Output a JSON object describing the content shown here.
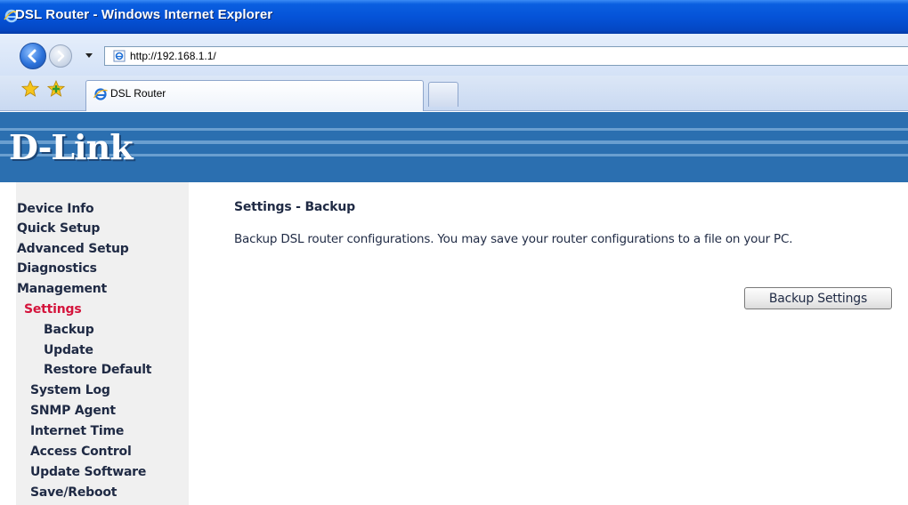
{
  "window": {
    "title": "DSL Router - Windows Internet Explorer"
  },
  "browser": {
    "address_url": "http://192.168.1.1/",
    "tab_label": "DSL Router"
  },
  "brand": {
    "logo_text": "D-Link"
  },
  "sidebar": {
    "items": [
      {
        "label": "Device Info",
        "active": false
      },
      {
        "label": "Quick Setup",
        "active": false
      },
      {
        "label": "Advanced Setup",
        "active": false
      },
      {
        "label": "Diagnostics",
        "active": false
      },
      {
        "label": "Management",
        "active": false
      },
      {
        "label": "Settings",
        "active": true
      },
      {
        "label": "Backup",
        "active": false
      },
      {
        "label": "Update",
        "active": false
      },
      {
        "label": "Restore Default",
        "active": false
      },
      {
        "label": "System Log",
        "active": false
      },
      {
        "label": "SNMP Agent",
        "active": false
      },
      {
        "label": "Internet Time",
        "active": false
      },
      {
        "label": "Access Control",
        "active": false
      },
      {
        "label": "Update Software",
        "active": false
      },
      {
        "label": "Save/Reboot",
        "active": false
      }
    ]
  },
  "main": {
    "title": "Settings - Backup",
    "description": "Backup DSL router configurations. You may save your router configurations to a file on your PC.",
    "backup_button_label": "Backup Settings"
  },
  "colors": {
    "banner": "#2b6fb0",
    "active_menu": "#d4143c",
    "text": "#1f2a44",
    "sidebar_bg": "#f0f0f0"
  },
  "icons": {
    "window_icon": "internet-explorer-icon",
    "back": "back-arrow-icon",
    "forward": "forward-arrow-icon",
    "favorites": "favorites-star-icon",
    "add_favorites": "add-to-favorites-icon"
  }
}
